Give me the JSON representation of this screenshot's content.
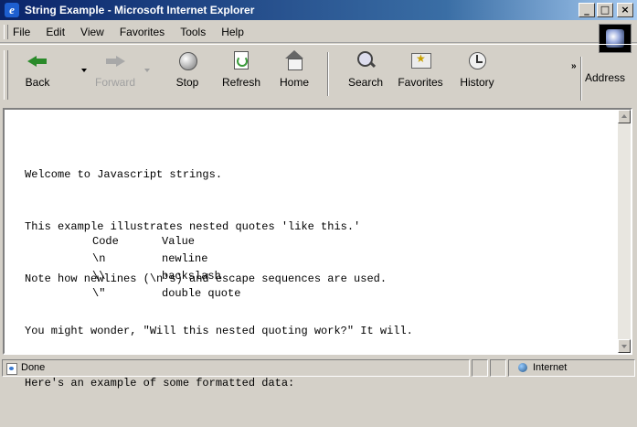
{
  "window": {
    "title": "String Example - Microsoft Internet Explorer",
    "icons": {
      "app": "ie-logo-icon",
      "minimize": "minimize-icon",
      "maximize": "maximize-icon",
      "close": "close-icon"
    }
  },
  "menu": {
    "items": [
      {
        "label": "File"
      },
      {
        "label": "Edit"
      },
      {
        "label": "View"
      },
      {
        "label": "Favorites"
      },
      {
        "label": "Tools"
      },
      {
        "label": "Help"
      }
    ]
  },
  "toolbar": {
    "buttons": [
      {
        "label": "Back",
        "icon": "back-arrow-icon",
        "enabled": true
      },
      {
        "label": "Forward",
        "icon": "forward-arrow-icon",
        "enabled": false
      },
      {
        "label": "Stop",
        "icon": "stop-icon",
        "enabled": true
      },
      {
        "label": "Refresh",
        "icon": "refresh-icon",
        "enabled": true
      },
      {
        "label": "Home",
        "icon": "home-icon",
        "enabled": true
      },
      {
        "label": "Search",
        "icon": "search-icon",
        "enabled": true
      },
      {
        "label": "Favorites",
        "icon": "favorites-icon",
        "enabled": true
      },
      {
        "label": "History",
        "icon": "history-icon",
        "enabled": true
      }
    ],
    "chevron": "»",
    "address_label": "Address"
  },
  "document": {
    "lines": [
      "Welcome to Javascript strings.",
      "This example illustrates nested quotes 'like this.'",
      "Note how newlines (\\n's) and escape sequences are used.",
      "You might wonder, \"Will this nested quoting work?\" It will.",
      "Here's an example of some formatted data:"
    ],
    "table": {
      "headers": [
        "Code",
        "Value"
      ],
      "rows": [
        [
          "\\n",
          "newline"
        ],
        [
          "\\\\",
          "backslash"
        ],
        [
          "\\\"",
          "double quote"
        ]
      ]
    }
  },
  "status": {
    "text": "Done",
    "zone": "Internet",
    "icons": {
      "page": "page-done-icon",
      "zone": "internet-globe-icon"
    }
  },
  "colors": {
    "titlebar_start": "#0a246a",
    "titlebar_end": "#a6caf0",
    "chrome": "#d4d0c8",
    "page_background": "#ffffff"
  }
}
